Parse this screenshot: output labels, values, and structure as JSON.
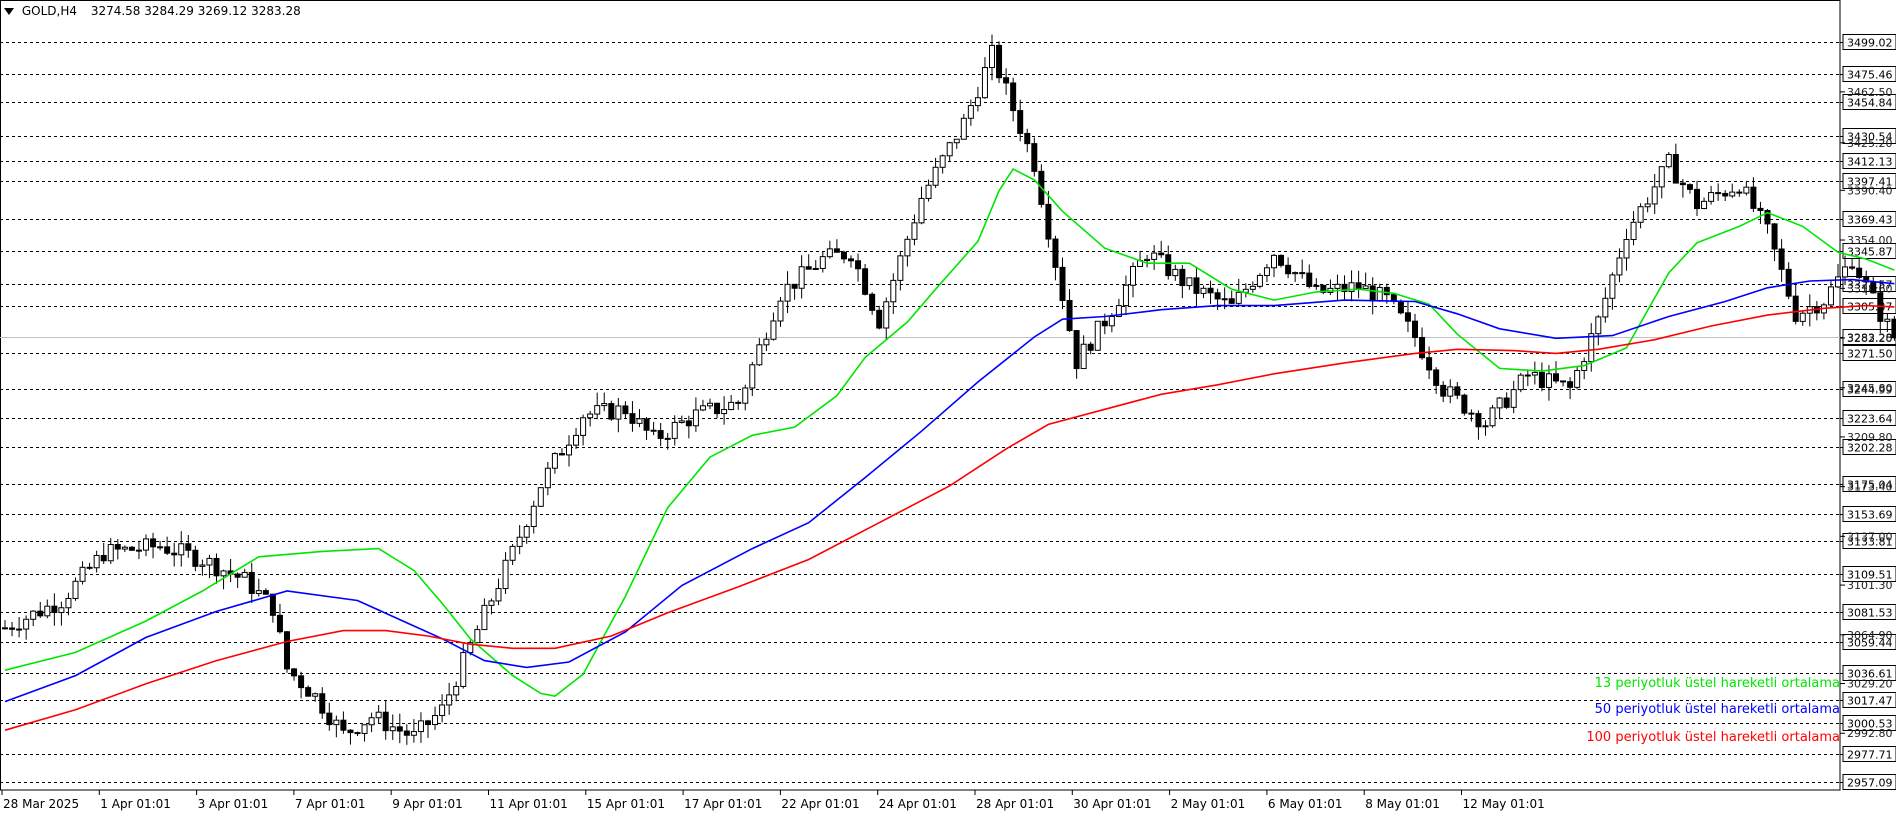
{
  "header": {
    "symbol": "GOLD,H4",
    "ohlc": "3274.58 3284.29 3269.12 3283.28"
  },
  "legend": [
    {
      "label": "13 periyotluk üstel hareketli ortalama",
      "color": "#00e600"
    },
    {
      "label": "50 periyotluk üstel hareketli ortalama",
      "color": "#0000ff"
    },
    {
      "label": "100 periyotluk üstel hareketli ortalama",
      "color": "#ff0000"
    }
  ],
  "chart_data": {
    "type": "candlestick",
    "current_price": 3283.28,
    "y_labels_boxed": [
      "3499.02",
      "3475.46",
      "3454.84",
      "3430.54",
      "3412.13",
      "3397.41",
      "3369.43",
      "3345.87",
      "3321.57",
      "3305.37",
      "3283.28",
      "3271.50",
      "3244.99",
      "3223.64",
      "3202.28",
      "3175.04",
      "3153.69",
      "3133.81",
      "3109.51",
      "3081.53",
      "3059.44",
      "3036.61",
      "3017.47",
      "3000.53",
      "2977.71",
      "2957.09"
    ],
    "y_labels_light": [
      "3462.50",
      "3425.20",
      "3390.40",
      "3354.00",
      "3318.60",
      "3282.20",
      "3245.80",
      "3209.80",
      "3173.40",
      "3137.00",
      "3101.30",
      "3064.90",
      "3029.20",
      "2992.80"
    ],
    "x_labels": [
      "28 Mar 2025",
      "1 Apr 01:01",
      "3 Apr 01:01",
      "7 Apr 01:01",
      "9 Apr 01:01",
      "11 Apr 01:01",
      "15 Apr 01:01",
      "17 Apr 01:01",
      "22 Apr 01:01",
      "24 Apr 01:01",
      "28 Apr 01:01",
      "30 Apr 01:01",
      "2 May 01:01",
      "6 May 01:01",
      "8 May 01:01",
      "12 May 01:01"
    ],
    "series": [
      {
        "name": "13 periyotluk üstel hareketli ortalama",
        "color": "#00e600",
        "points": [
          [
            0,
            3039
          ],
          [
            10,
            3052
          ],
          [
            20,
            3075
          ],
          [
            28,
            3097
          ],
          [
            36,
            3122
          ],
          [
            45,
            3126
          ],
          [
            53,
            3128
          ],
          [
            58,
            3112
          ],
          [
            62,
            3088
          ],
          [
            66,
            3062
          ],
          [
            72,
            3035
          ],
          [
            76,
            3022
          ],
          [
            78,
            3020
          ],
          [
            82,
            3036
          ],
          [
            88,
            3093
          ],
          [
            94,
            3158
          ],
          [
            100,
            3195
          ],
          [
            106,
            3211
          ],
          [
            112,
            3217
          ],
          [
            118,
            3240
          ],
          [
            122,
            3268
          ],
          [
            128,
            3294
          ],
          [
            132,
            3318
          ],
          [
            138,
            3353
          ],
          [
            141,
            3390
          ],
          [
            143,
            3406
          ],
          [
            146,
            3398
          ],
          [
            150,
            3375
          ],
          [
            156,
            3348
          ],
          [
            162,
            3337
          ],
          [
            168,
            3337
          ],
          [
            174,
            3318
          ],
          [
            180,
            3310
          ],
          [
            186,
            3316
          ],
          [
            192,
            3318
          ],
          [
            197,
            3315
          ],
          [
            202,
            3307
          ],
          [
            206,
            3285
          ],
          [
            212,
            3260
          ],
          [
            218,
            3258
          ],
          [
            224,
            3262
          ],
          [
            230,
            3275
          ],
          [
            236,
            3330
          ],
          [
            240,
            3352
          ],
          [
            246,
            3364
          ],
          [
            250,
            3374
          ],
          [
            255,
            3364
          ],
          [
            260,
            3345
          ],
          [
            264,
            3340
          ],
          [
            268,
            3332
          ]
        ]
      },
      {
        "name": "50 periyotluk üstel hareketli ortalama",
        "color": "#0000ff",
        "points": [
          [
            0,
            3016
          ],
          [
            10,
            3035
          ],
          [
            20,
            3063
          ],
          [
            30,
            3082
          ],
          [
            40,
            3097
          ],
          [
            50,
            3090
          ],
          [
            56,
            3076
          ],
          [
            62,
            3062
          ],
          [
            68,
            3046
          ],
          [
            74,
            3041
          ],
          [
            80,
            3045
          ],
          [
            88,
            3067
          ],
          [
            96,
            3101
          ],
          [
            106,
            3128
          ],
          [
            114,
            3147
          ],
          [
            122,
            3180
          ],
          [
            130,
            3214
          ],
          [
            138,
            3250
          ],
          [
            146,
            3283
          ],
          [
            150,
            3296
          ],
          [
            156,
            3298
          ],
          [
            164,
            3303
          ],
          [
            172,
            3306
          ],
          [
            180,
            3306
          ],
          [
            190,
            3310
          ],
          [
            200,
            3309
          ],
          [
            206,
            3300
          ],
          [
            212,
            3289
          ],
          [
            220,
            3282
          ],
          [
            228,
            3284
          ],
          [
            236,
            3298
          ],
          [
            244,
            3309
          ],
          [
            250,
            3319
          ],
          [
            256,
            3324
          ],
          [
            262,
            3325
          ],
          [
            268,
            3322
          ]
        ]
      },
      {
        "name": "100 periyotluk üstel hareketli ortalama",
        "color": "#ff0000",
        "points": [
          [
            0,
            2995
          ],
          [
            10,
            3010
          ],
          [
            20,
            3029
          ],
          [
            30,
            3046
          ],
          [
            40,
            3060
          ],
          [
            48,
            3068
          ],
          [
            54,
            3068
          ],
          [
            60,
            3064
          ],
          [
            66,
            3058
          ],
          [
            72,
            3055
          ],
          [
            78,
            3055
          ],
          [
            86,
            3064
          ],
          [
            94,
            3081
          ],
          [
            104,
            3100
          ],
          [
            114,
            3120
          ],
          [
            124,
            3147
          ],
          [
            134,
            3174
          ],
          [
            142,
            3201
          ],
          [
            148,
            3219
          ],
          [
            156,
            3230
          ],
          [
            164,
            3241
          ],
          [
            172,
            3248
          ],
          [
            180,
            3256
          ],
          [
            190,
            3264
          ],
          [
            200,
            3271
          ],
          [
            206,
            3274
          ],
          [
            214,
            3273
          ],
          [
            220,
            3271
          ],
          [
            226,
            3274
          ],
          [
            234,
            3281
          ],
          [
            242,
            3291
          ],
          [
            250,
            3299
          ],
          [
            258,
            3304
          ],
          [
            264,
            3306
          ],
          [
            268,
            3305
          ]
        ]
      }
    ]
  }
}
